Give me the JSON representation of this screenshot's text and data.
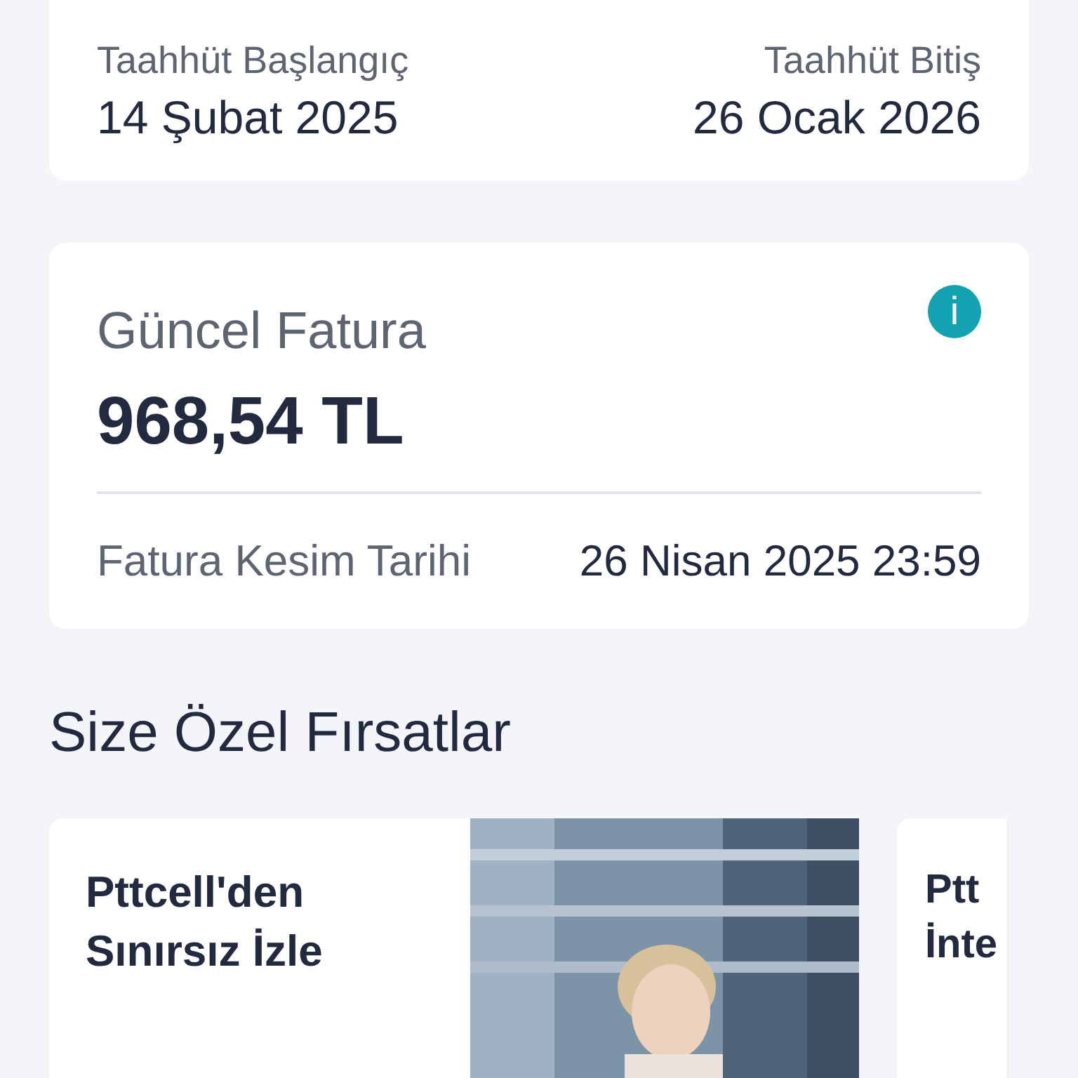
{
  "commitment": {
    "start": {
      "label": "Taahhüt Başlangıç",
      "value": "14 Şubat 2025"
    },
    "end": {
      "label": "Taahhüt Bitiş",
      "value": "26 Ocak 2026"
    }
  },
  "bill": {
    "title": "Güncel Fatura",
    "info_icon": "i",
    "amount": "968,54 TL",
    "due_label": "Fatura Kesim Tarihi",
    "due_value": "26 Nisan 2025 23:59"
  },
  "offers": {
    "title": "Size Özel Fırsatlar",
    "items": [
      {
        "title": "Pttcell'den Sınırsız İzle",
        "kind": "picture"
      },
      {
        "title": "Ptt İnte",
        "kind": "text"
      }
    ]
  }
}
